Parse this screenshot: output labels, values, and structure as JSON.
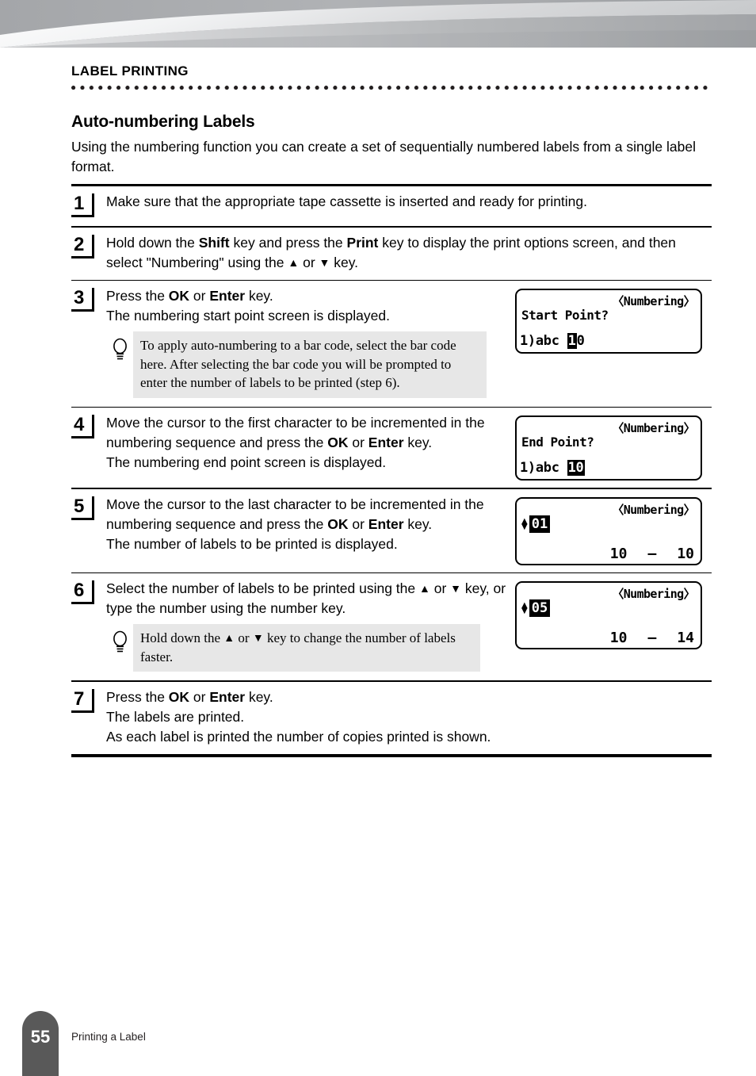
{
  "header": {
    "chapter": "LABEL PRINTING"
  },
  "section": {
    "title": "Auto-numbering Labels",
    "intro": "Using the numbering function you can create a set of sequentially numbered labels from a single label format."
  },
  "steps": [
    {
      "number": "1",
      "lines": [
        "Make sure that the appropriate tape cassette is inserted and ready for printing."
      ]
    },
    {
      "number": "2",
      "lines": [
        "Hold down the Shift key and press the Print key to display the print options screen, and then select \"Numbering\" using the ▲ or ▼ key."
      ]
    },
    {
      "number": "3",
      "lines": [
        "Press the OK or Enter key.",
        "The numbering start point screen is displayed."
      ],
      "tip": "To apply auto-numbering to a bar code, select the bar code here. After selecting the bar code you will be prompted to enter the number of labels to be printed (step 6).",
      "lcd": {
        "mode": "〈Numbering〉",
        "prompt": "Start Point?",
        "entry_prefix": "1)abc",
        "entry_highlight": "1",
        "entry_rest": "0"
      }
    },
    {
      "number": "4",
      "lines": [
        "Move the cursor to the first character to be incremented in the numbering sequence and press the OK or Enter key.",
        "The numbering end point screen is displayed."
      ],
      "lcd": {
        "mode": "〈Numbering〉",
        "prompt": "End Point?",
        "entry_prefix": "1)abc",
        "entry_highlight": "10",
        "entry_rest": ""
      }
    },
    {
      "number": "5",
      "lines": [
        "Move the cursor to the last character to be incremented in the numbering sequence and press the OK or Enter key.",
        "The number of labels to be printed is displayed."
      ],
      "lcd": {
        "mode": "〈Numbering〉",
        "count": "01",
        "range_start": "10",
        "range_sep": "–",
        "range_end": "10"
      }
    },
    {
      "number": "6",
      "lines": [
        "Select the number of labels to be printed using the ▲ or ▼ key, or type the number using the number key."
      ],
      "tip": "Hold down the ▲ or ▼ key to change the number of labels faster.",
      "lcd": {
        "mode": "〈Numbering〉",
        "count": "05",
        "range_start": "10",
        "range_sep": "–",
        "range_end": "14"
      }
    },
    {
      "number": "7",
      "lines": [
        "Press the OK or Enter key.",
        "The labels are printed.",
        "As each label is printed the number of copies printed is shown."
      ]
    }
  ],
  "step_text": {
    "s1_l1": "Make sure that the appropriate tape cassette is inserted and ready for printing.",
    "s2_a": "Hold down the ",
    "s2_shift": "Shift",
    "s2_b": " key and press the ",
    "s2_print": "Print",
    "s2_c": " key to display the print options screen, and then select \"Numbering\" using the ",
    "s2_up": "▲",
    "s2_d": " or ",
    "s2_down": "▼",
    "s2_e": " key.",
    "s3_a": "Press the ",
    "s3_ok": "OK",
    "s3_b": " or ",
    "s3_enter": "Enter",
    "s3_c": " key.",
    "s3_l2": "The numbering start point screen is displayed.",
    "s3_tip": "To apply auto-numbering to a bar code, select the bar code here. After selecting the bar code you will be prompted to enter the number of labels to be printed (step 6).",
    "s4_a": "Move the cursor to the first character to be incremented in the numbering sequence and press the ",
    "s4_ok": "OK",
    "s4_b": " or ",
    "s4_enter": "Enter",
    "s4_c": " key.",
    "s4_l2": "The numbering end point screen is displayed.",
    "s5_a": "Move the cursor to the last character to be incremented in the numbering sequence and press the ",
    "s5_ok": "OK",
    "s5_b": " or ",
    "s5_enter": "Enter",
    "s5_c": " key.",
    "s5_l2": "The number of labels to be printed is displayed.",
    "s6_a": "Select the number of labels to be printed using the ",
    "s6_up": "▲",
    "s6_b": " or ",
    "s6_down": "▼",
    "s6_c": " key, or type the number using the number key.",
    "s6_tip_a": "Hold down the ",
    "s6_tip_up": "▲",
    "s6_tip_b": " or ",
    "s6_tip_down": "▼",
    "s6_tip_c": " key to change the number of labels faster.",
    "s7_a": "Press the ",
    "s7_ok": "OK",
    "s7_b": " or ",
    "s7_enter": "Enter",
    "s7_c": " key.",
    "s7_l2": "The labels are printed.",
    "s7_l3": "As each label is printed the number of copies printed is shown."
  },
  "footer": {
    "page_number": "55",
    "running_title": "Printing a Label"
  },
  "colors": {
    "text": "#000000",
    "tip_background": "#e7e7e7",
    "footer_tab": "#595959",
    "banner_dark": "#a6a8ab",
    "banner_light": "#ffffff"
  }
}
